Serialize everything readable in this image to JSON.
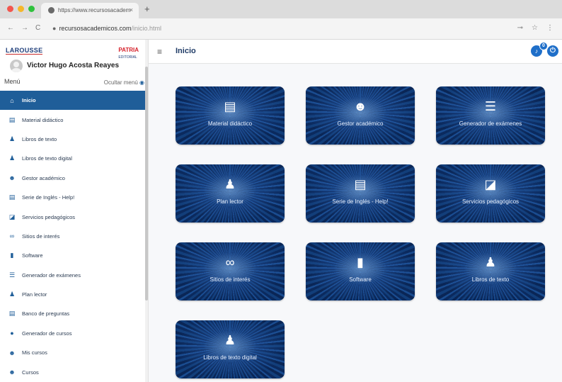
{
  "browser": {
    "tab_title": "https://www.recursosacadem",
    "tab_close": "×",
    "new_tab": "+",
    "nav_back": "←",
    "nav_forward": "→",
    "nav_reload": "C",
    "url_host": "recursosacademicos.com",
    "url_path": "/inicio.html",
    "key_icon": "⊸",
    "star_icon": "☆",
    "menu_icon": "⋮"
  },
  "sidebar": {
    "logo_left": "LAROUSSE",
    "logo_right_red": "PATRIA",
    "logo_right": "EDITORIAL",
    "user_name": "Victor Hugo Acosta Reayes",
    "menu_label": "Menú",
    "hide_menu": "Ocultar menú",
    "items": [
      {
        "label": "Inicio",
        "icon": "home-icon"
      },
      {
        "label": "Material didáctico",
        "icon": "book-icon"
      },
      {
        "label": "Libros de texto",
        "icon": "reader-icon"
      },
      {
        "label": "Libros de texto digital",
        "icon": "reader-icon"
      },
      {
        "label": "Gestor académico",
        "icon": "users-icon"
      },
      {
        "label": "Serie de Inglés - Help!",
        "icon": "book-icon"
      },
      {
        "label": "Servicios pedagógicos",
        "icon": "presentation-icon"
      },
      {
        "label": "Sitios de interés",
        "icon": "link-icon"
      },
      {
        "label": "Software",
        "icon": "device-icon"
      },
      {
        "label": "Generador de exámenes",
        "icon": "list-icon"
      },
      {
        "label": "Plan lector",
        "icon": "reader-icon"
      },
      {
        "label": "Banco de preguntas",
        "icon": "book-icon"
      },
      {
        "label": "Generador de cursos",
        "icon": "circle-icon"
      },
      {
        "label": "Mis cursos",
        "icon": "users-icon"
      },
      {
        "label": "Cursos",
        "icon": "users-icon"
      }
    ]
  },
  "header": {
    "title": "Inicio",
    "notification_count": "0"
  },
  "cards": [
    {
      "label": "Material didáctico",
      "icon": "book-icon"
    },
    {
      "label": "Gestor académico",
      "icon": "users-icon"
    },
    {
      "label": "Generador de exámenes",
      "icon": "list-icon"
    },
    {
      "label": "Plan lector",
      "icon": "reader-icon"
    },
    {
      "label": "Serie de Inglés - Help!",
      "icon": "book-icon"
    },
    {
      "label": "Servicios pedagógicos",
      "icon": "presentation-icon"
    },
    {
      "label": "Sitios de interés",
      "icon": "link-icon"
    },
    {
      "label": "Software",
      "icon": "device-icon"
    },
    {
      "label": "Libros de texto",
      "icon": "reader-icon"
    },
    {
      "label": "Libros de texto digital",
      "icon": "reader-icon"
    }
  ],
  "colors": {
    "accent": "#1f5e99",
    "card_bg": "#0c2f66",
    "header_icon": "#1f6fc9"
  }
}
